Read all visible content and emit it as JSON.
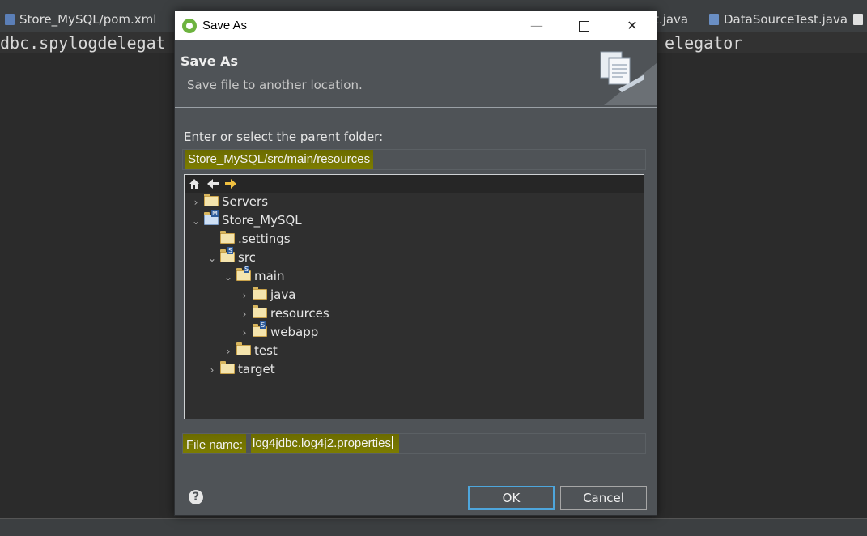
{
  "ide": {
    "tabs": [
      {
        "label": "Store_MySQL/pom.xml",
        "icon": "maven-file-icon"
      },
      {
        "label": "t.java",
        "icon": "java-file-icon"
      },
      {
        "label": "DataSourceTest.java",
        "icon": "java-file-icon"
      }
    ],
    "code_left": "dbc.spylogdelegat",
    "code_right": "elegator"
  },
  "dialog": {
    "window_title": "Save As",
    "minimize_glyph": "—",
    "close_glyph": "✕",
    "banner_title": "Save As",
    "banner_description": "Save file to another location.",
    "parent_folder_label": "Enter or select the parent folder:",
    "parent_folder_value": "Store_MySQL/src/main/resources",
    "tree_toolbar": {
      "home": "home-icon",
      "back": "back-arrow-icon",
      "forward": "forward-arrow-icon"
    },
    "tree": {
      "servers": "Servers",
      "store_mysql": "Store_MySQL",
      "settings": ".settings",
      "src": "src",
      "main": "main",
      "java": "java",
      "resources": "resources",
      "webapp": "webapp",
      "test": "test",
      "target": "target"
    },
    "file_name_label": "File name:",
    "file_name_value": "log4jdbc.log4j2.properties",
    "ok_label": "OK",
    "cancel_label": "Cancel",
    "help_glyph": "?"
  },
  "colors": {
    "dialog_bg": "#4f5357",
    "highlight": "#7d7d00",
    "ok_border": "#4ea6dc",
    "editor_bg": "#2b2b2b"
  }
}
